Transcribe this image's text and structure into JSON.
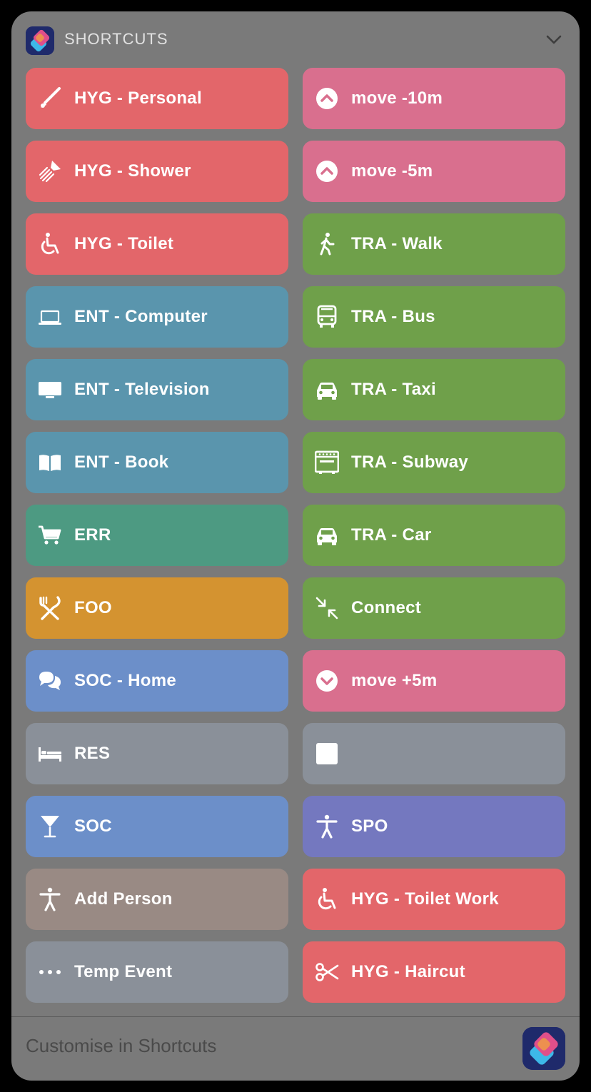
{
  "header": {
    "title": "SHORTCUTS",
    "app_icon": "shortcuts-app-icon",
    "collapse_icon": "chevron-down-icon"
  },
  "tiles": [
    {
      "label": "HYG - Personal",
      "color": "red",
      "icon": "toothbrush-icon"
    },
    {
      "label": "move -10m",
      "color": "pink",
      "icon": "chevron-up-circle-icon"
    },
    {
      "label": "HYG - Shower",
      "color": "red",
      "icon": "shower-icon"
    },
    {
      "label": "move -5m",
      "color": "pink",
      "icon": "chevron-up-circle-icon"
    },
    {
      "label": "HYG - Toilet",
      "color": "red",
      "icon": "wheelchair-icon"
    },
    {
      "label": "TRA - Walk",
      "color": "green",
      "icon": "walking-icon"
    },
    {
      "label": "ENT - Computer",
      "color": "teal-blue",
      "icon": "laptop-icon"
    },
    {
      "label": "TRA - Bus",
      "color": "green",
      "icon": "bus-icon"
    },
    {
      "label": "ENT - Television",
      "color": "teal-blue",
      "icon": "television-icon"
    },
    {
      "label": "TRA - Taxi",
      "color": "green",
      "icon": "car-icon"
    },
    {
      "label": "ENT - Book",
      "color": "teal-blue",
      "icon": "book-icon"
    },
    {
      "label": "TRA - Subway",
      "color": "green",
      "icon": "subway-icon"
    },
    {
      "label": "ERR",
      "color": "teal",
      "icon": "cart-icon"
    },
    {
      "label": "TRA - Car",
      "color": "green",
      "icon": "car-icon"
    },
    {
      "label": "FOO",
      "color": "orange",
      "icon": "fork-knife-icon"
    },
    {
      "label": "Connect",
      "color": "green",
      "icon": "arrows-inward-icon"
    },
    {
      "label": "SOC - Home",
      "color": "blue",
      "icon": "chat-bubbles-icon"
    },
    {
      "label": "move +5m",
      "color": "pink",
      "icon": "chevron-down-circle-icon"
    },
    {
      "label": "RES",
      "color": "gray",
      "icon": "bed-icon"
    },
    {
      "label": "",
      "color": "gray",
      "icon": "square-icon"
    },
    {
      "label": "SOC",
      "color": "blue",
      "icon": "cocktail-icon"
    },
    {
      "label": "SPO",
      "color": "purple",
      "icon": "person-icon"
    },
    {
      "label": "Add Person",
      "color": "taupe",
      "icon": "person-icon"
    },
    {
      "label": "HYG - Toilet Work",
      "color": "red",
      "icon": "wheelchair-icon"
    },
    {
      "label": "Temp Event",
      "color": "gray",
      "icon": "ellipsis-icon"
    },
    {
      "label": "HYG - Haircut",
      "color": "red",
      "icon": "scissors-icon"
    }
  ],
  "footer": {
    "text": "Customise in Shortcuts",
    "app_icon": "shortcuts-app-icon"
  }
}
